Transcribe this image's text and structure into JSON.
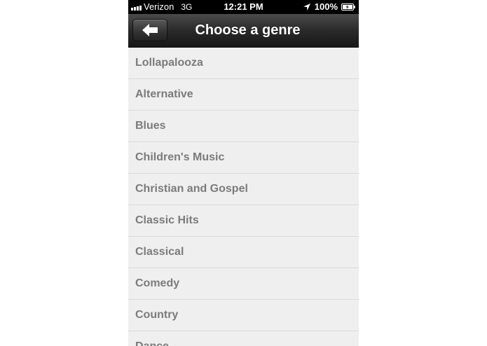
{
  "status_bar": {
    "carrier": "Verizon",
    "network": "3G",
    "time": "12:21 PM",
    "battery": "100%",
    "icons": [
      "signal-icon",
      "location-arrow-icon",
      "battery-charging-icon"
    ]
  },
  "nav_bar": {
    "title": "Choose a genre",
    "back_icon": "back-arrow-icon"
  },
  "genres": [
    "Lollapalooza",
    "Alternative",
    "Blues",
    "Children's Music",
    "Christian and Gospel",
    "Classic Hits",
    "Classical",
    "Comedy",
    "Country",
    "Dance"
  ],
  "colors": {
    "nav_bar": "#2a2a2a",
    "list_background": "#efefef",
    "list_text": "#7b7b7b",
    "divider": "#d9d9d9"
  }
}
